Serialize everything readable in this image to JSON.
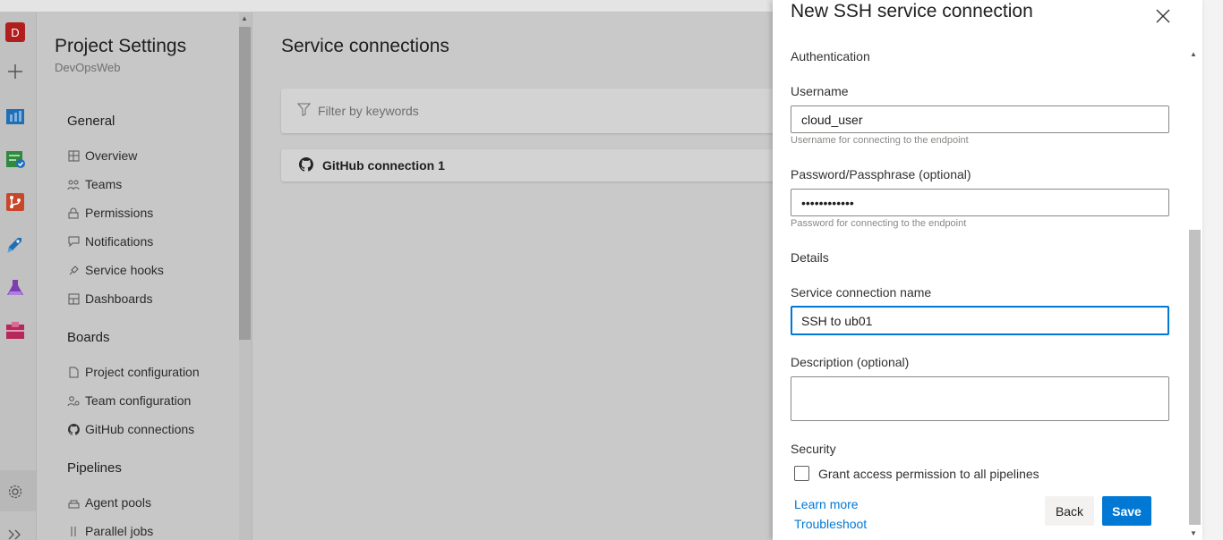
{
  "rail": {
    "avatar_letter": "D",
    "icons": [
      "plus-icon",
      "boards-icon",
      "test-plans-icon",
      "repos-icon",
      "pipelines-icon",
      "flask-icon",
      "artifacts-icon"
    ],
    "settings_icon": "gear-icon",
    "expand_icon": "double-chevron-right-icon"
  },
  "nav": {
    "title": "Project Settings",
    "subtitle": "DevOpsWeb",
    "sections": [
      {
        "label": "General",
        "items": [
          "Overview",
          "Teams",
          "Permissions",
          "Notifications",
          "Service hooks",
          "Dashboards"
        ]
      },
      {
        "label": "Boards",
        "items": [
          "Project configuration",
          "Team configuration",
          "GitHub connections"
        ]
      },
      {
        "label": "Pipelines",
        "items": [
          "Agent pools",
          "Parallel jobs"
        ]
      }
    ]
  },
  "main": {
    "title": "Service connections",
    "filter_placeholder": "Filter by keywords",
    "connection_name": "GitHub connection 1"
  },
  "panel": {
    "title": "New SSH service connection",
    "auth_section": "Authentication",
    "username_label": "Username",
    "username_value": "cloud_user",
    "username_help": "Username for connecting to the endpoint",
    "password_label": "Password/Passphrase (optional)",
    "password_value": "••••••••••••",
    "password_help": "Password for connecting to the endpoint",
    "details_section": "Details",
    "name_label": "Service connection name",
    "name_value": "SSH to ub01",
    "description_label": "Description (optional)",
    "description_value": "",
    "security_section": "Security",
    "grant_label": "Grant access permission to all pipelines",
    "learn_more": "Learn more",
    "troubleshoot": "Troubleshoot",
    "back_label": "Back",
    "save_label": "Save"
  },
  "colors": {
    "accent": "#0078d4",
    "avatar_bg": "#b01e1e"
  }
}
